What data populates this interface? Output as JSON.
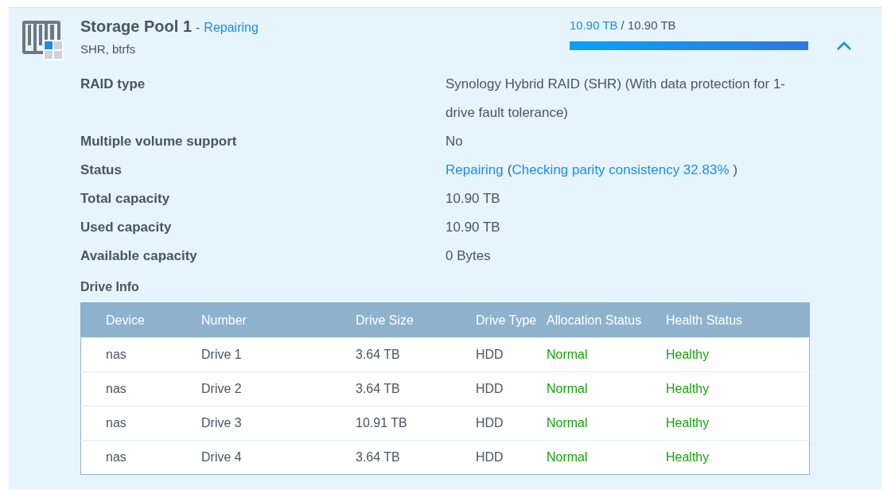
{
  "pool": {
    "title": "Storage Pool 1",
    "separator": "-",
    "state": "Repairing",
    "subtitle": "SHR, btrfs",
    "used": "10.90 TB",
    "total": "/ 10.90 TB",
    "level": 1.0,
    "expanded": true
  },
  "details": [
    {
      "label": "RAID type",
      "parts": [
        {
          "text": "Synology Hybrid RAID (SHR) (With data protection for 1-drive fault tolerance)",
          "kind": "plain"
        }
      ]
    },
    {
      "label": "Multiple volume support",
      "parts": [
        {
          "text": "No",
          "kind": "plain"
        }
      ]
    },
    {
      "label": "Status",
      "parts": [
        {
          "text": "Repairing",
          "kind": "link"
        },
        {
          "text": "(",
          "kind": "plain"
        },
        {
          "text": "Checking parity consistency 32.83%",
          "kind": "link"
        },
        {
          "text": ")",
          "kind": "plain"
        }
      ]
    },
    {
      "label": "Total capacity",
      "parts": [
        {
          "text": "10.90 TB",
          "kind": "plain"
        }
      ]
    },
    {
      "label": "Used capacity",
      "parts": [
        {
          "text": "10.90 TB",
          "kind": "plain"
        }
      ]
    },
    {
      "label": "Available capacity",
      "parts": [
        {
          "text": "0 Bytes",
          "kind": "plain"
        }
      ]
    }
  ],
  "drive_info": {
    "title": "Drive Info",
    "columns": [
      {
        "label": "Device",
        "kind": "text"
      },
      {
        "label": "Number",
        "kind": "text"
      },
      {
        "label": "Drive Size",
        "kind": "text"
      },
      {
        "label": "Drive Type",
        "kind": "text"
      },
      {
        "label": "Allocation Status",
        "kind": "status"
      },
      {
        "label": "Health Status",
        "kind": "status"
      }
    ],
    "rows": [
      [
        "nas",
        "Drive 1",
        "3.64 TB",
        "HDD",
        "Normal",
        "Healthy"
      ],
      [
        "nas",
        "Drive 2",
        "3.64 TB",
        "HDD",
        "Normal",
        "Healthy"
      ],
      [
        "nas",
        "Drive 3",
        "10.91 TB",
        "HDD",
        "Normal",
        "Healthy"
      ],
      [
        "nas",
        "Drive 4",
        "3.64 TB",
        "HDD",
        "Normal",
        "Healthy"
      ]
    ]
  }
}
